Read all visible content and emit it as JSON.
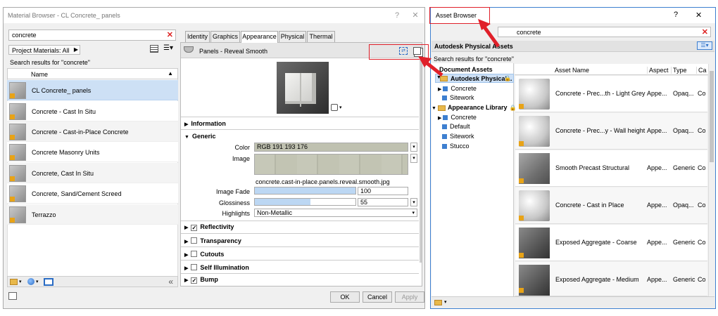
{
  "material_browser": {
    "title": "Material Browser - CL Concrete_ panels",
    "help": "?",
    "close": "✕",
    "search_value": "concrete",
    "search_clear": "✕",
    "filter_label": "Project Materials: All",
    "search_results": "Search results for \"concrete\"",
    "column_name": "Name",
    "items": [
      "CL Concrete_ panels",
      "Concrete - Cast In Situ",
      "Concrete - Cast-in-Place Concrete",
      "Concrete Masonry Units",
      "Concrete, Cast In Situ",
      "Concrete, Sand/Cement Screed",
      "Terrazzo"
    ]
  },
  "editor": {
    "tabs": [
      "Identity",
      "Graphics",
      "Appearance",
      "Physical",
      "Thermal"
    ],
    "asset_name": "Panels - Reveal Smooth",
    "sections": {
      "information": "Information",
      "generic": "Generic",
      "reflectivity": "Reflectivity",
      "transparency": "Transparency",
      "cutouts": "Cutouts",
      "self_illumination": "Self Illumination",
      "bump": "Bump"
    },
    "props": {
      "color_label": "Color",
      "color_value": "RGB 191 193 176",
      "image_label": "Image",
      "image_file": "concrete.cast-in-place.panels.reveal.smooth.jpg",
      "fade_label": "Image Fade",
      "fade_value": "100",
      "gloss_label": "Glossiness",
      "gloss_value": "55",
      "highlights_label": "Highlights",
      "highlights_value": "Non-Metallic"
    },
    "ok": "OK",
    "cancel": "Cancel",
    "apply": "Apply"
  },
  "asset_browser": {
    "title": "Asset Browser",
    "help": "?",
    "close": "✕",
    "search_value": "concrete",
    "search_clear": "✕",
    "library": "Autodesk Physical Assets",
    "search_results": "Search results for \"concrete\"",
    "tree": {
      "document_assets": "Document Assets",
      "autodesk_physical": "Autodesk Physical...",
      "concrete": "Concrete",
      "sitework": "Sitework",
      "appearance_library": "Appearance Library",
      "default": "Default",
      "stucco": "Stucco"
    },
    "columns": [
      "Asset Name",
      "Aspect",
      "Type",
      "Ca"
    ],
    "rows": [
      {
        "name": "Concrete - Prec...th - Light Grey",
        "aspect": "Appe...",
        "type": "Opaq...",
        "cat": "Co"
      },
      {
        "name": "Concrete - Prec...y - Wall height",
        "aspect": "Appe...",
        "type": "Opaq...",
        "cat": "Co"
      },
      {
        "name": "Smooth Precast Structural",
        "aspect": "Appe...",
        "type": "Generic",
        "cat": "Co"
      },
      {
        "name": "Concrete - Cast in Place",
        "aspect": "Appe...",
        "type": "Opaq...",
        "cat": "Co"
      },
      {
        "name": "Exposed Aggregate - Coarse",
        "aspect": "Appe...",
        "type": "Generic",
        "cat": "Co"
      },
      {
        "name": "Exposed Aggregate - Medium",
        "aspect": "Appe...",
        "type": "Generic",
        "cat": "Co"
      }
    ]
  },
  "colors": {
    "highlight_red": "#e0202a",
    "selection_blue": "#cde0f5",
    "accent_blue": "#3d7fd0"
  }
}
